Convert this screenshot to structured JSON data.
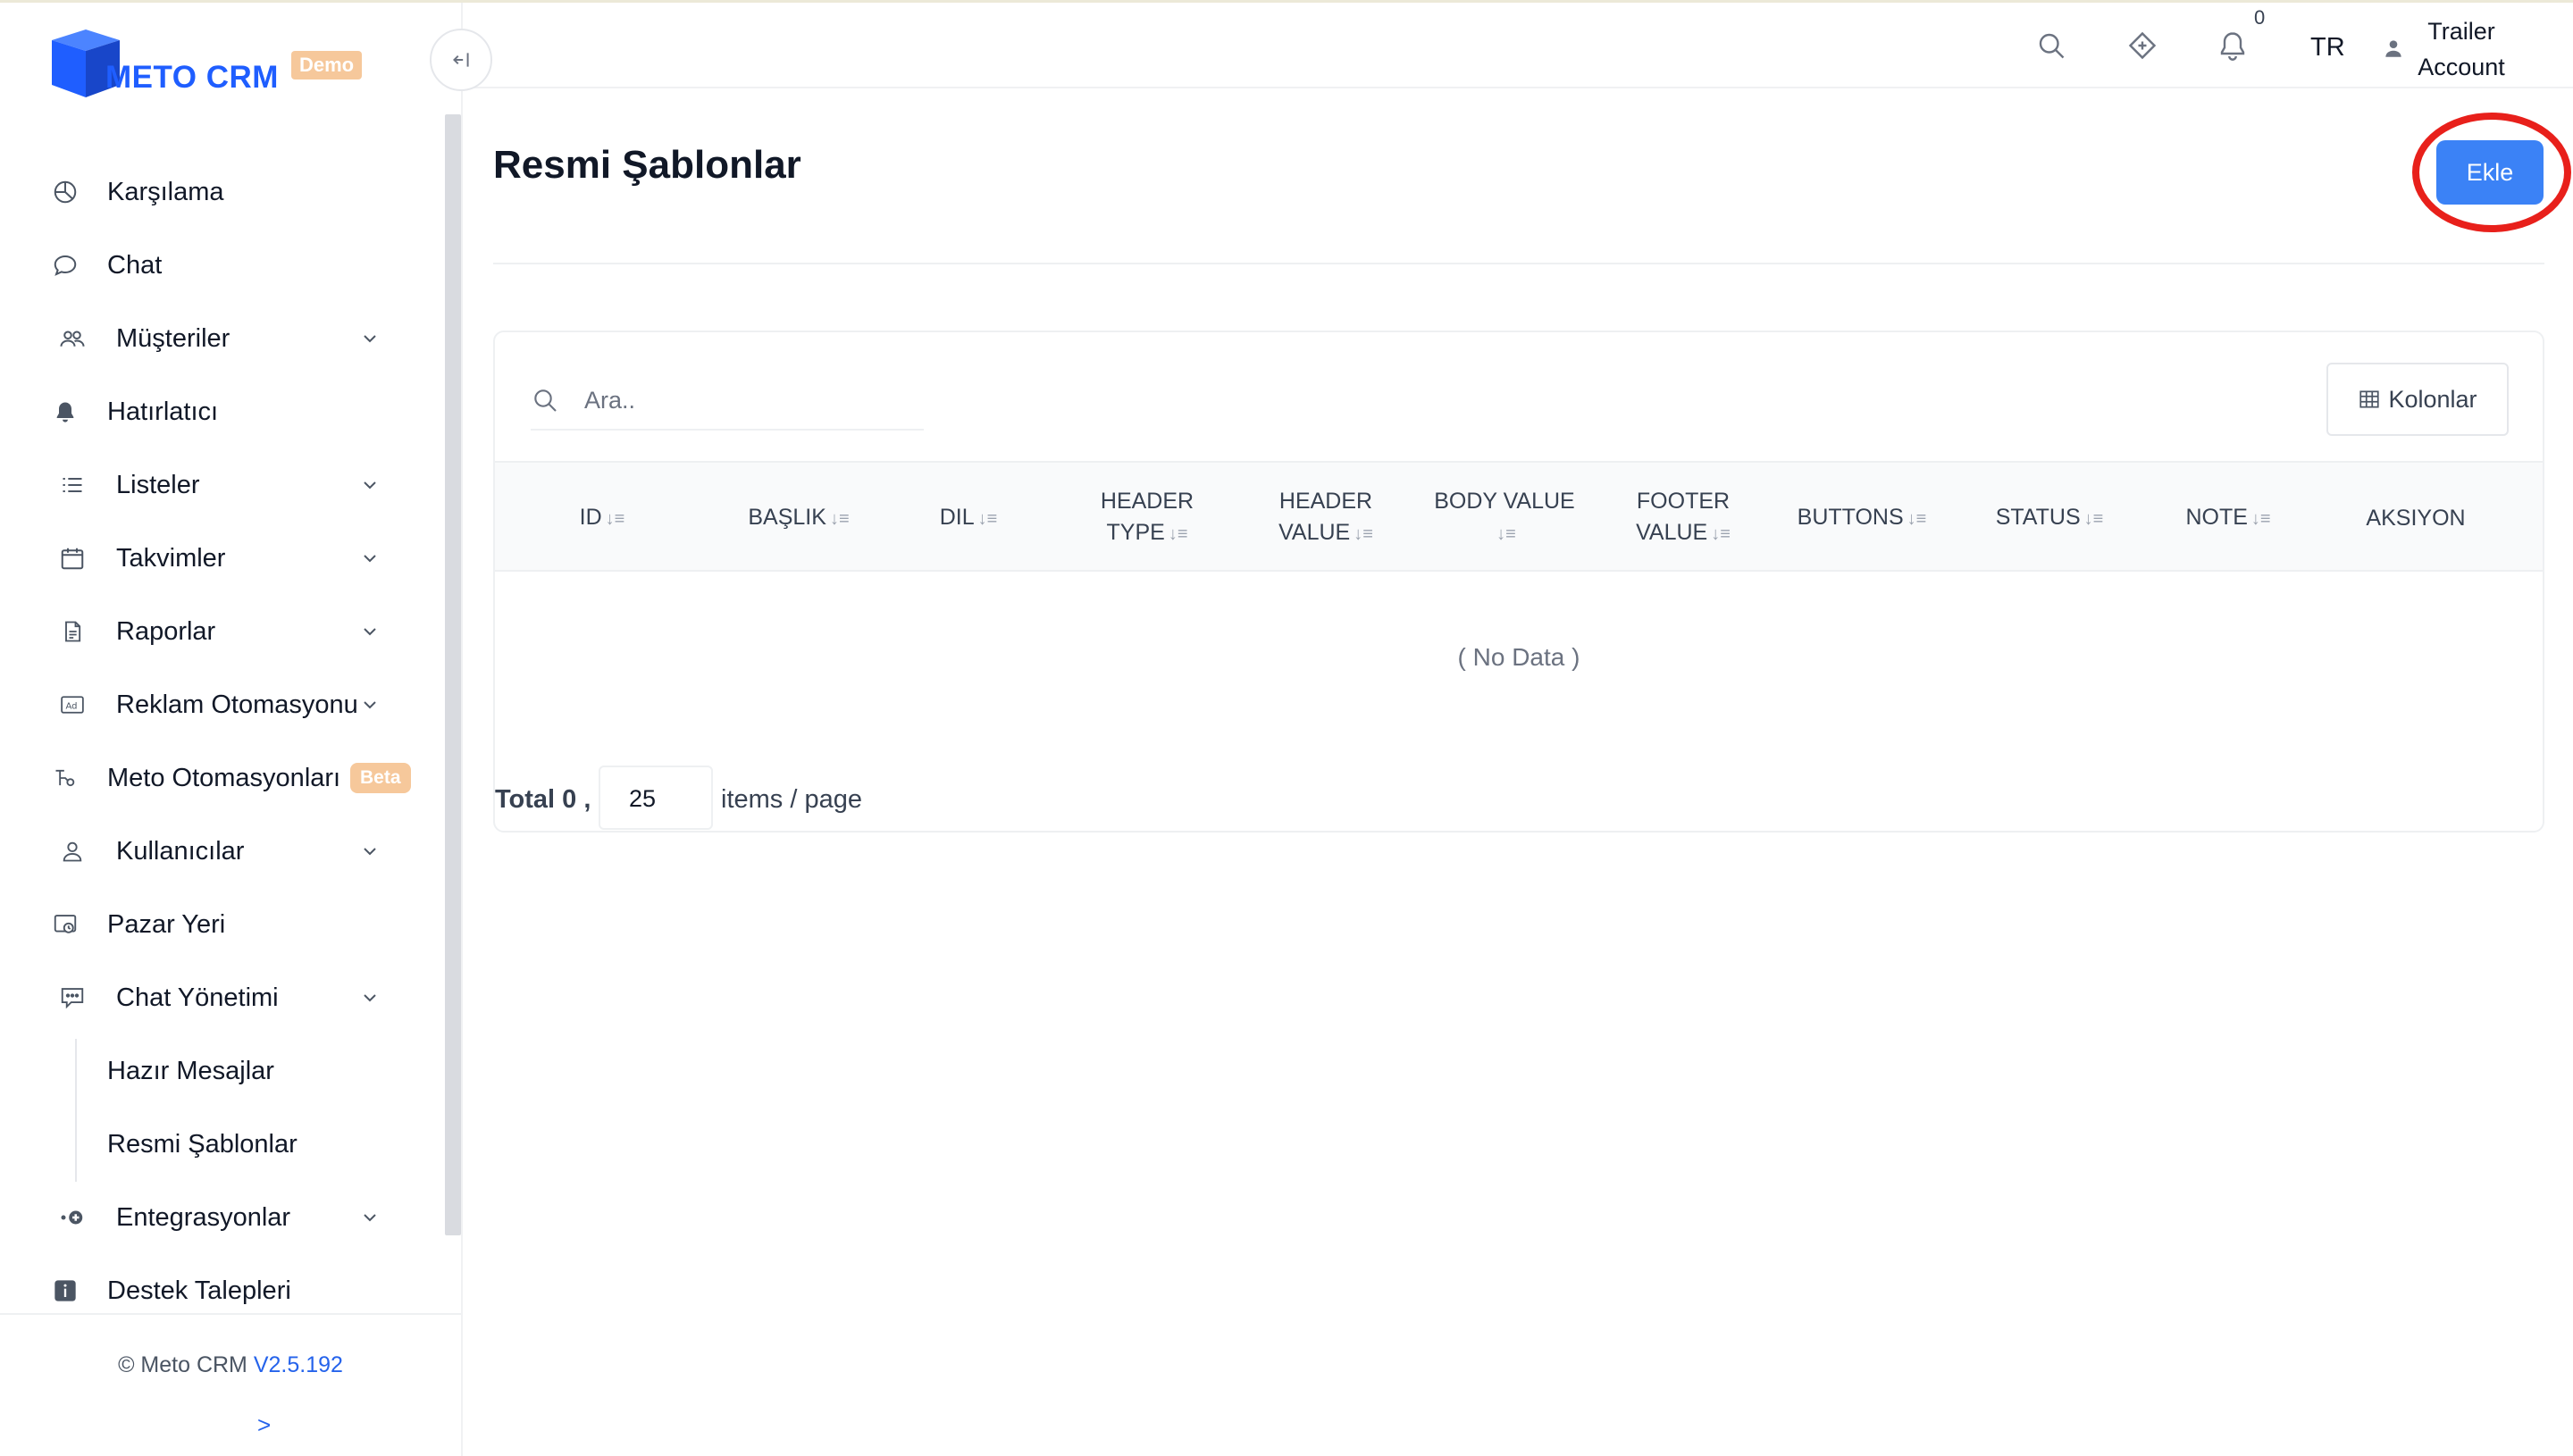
{
  "brand": {
    "name": "METO CRM",
    "badge": "Demo",
    "primary_color": "#1f5eff",
    "accent_color": "#f6c89b"
  },
  "sidebar": {
    "collapse_icon": "collapse-left-icon",
    "items": [
      {
        "label": "Karşılama",
        "icon": "pie-chart-icon",
        "has_children": false
      },
      {
        "label": "Chat",
        "icon": "chat-bubble-icon",
        "has_children": false
      },
      {
        "label": "Müşteriler",
        "icon": "users-icon",
        "has_children": true
      },
      {
        "label": "Hatırlatıcı",
        "icon": "bell-icon",
        "has_children": false
      },
      {
        "label": "Listeler",
        "icon": "list-icon",
        "has_children": true
      },
      {
        "label": "Takvimler",
        "icon": "calendar-icon",
        "has_children": true
      },
      {
        "label": "Raporlar",
        "icon": "report-icon",
        "has_children": true
      },
      {
        "label": "Reklam Otomasyonu",
        "icon": "ad-icon",
        "has_children": true
      },
      {
        "label": "Meto Otomasyonları",
        "icon": "automation-icon",
        "has_children": false,
        "badge": "Beta"
      },
      {
        "label": "Kullanıcılar",
        "icon": "user-icon",
        "has_children": true
      },
      {
        "label": "Pazar Yeri",
        "icon": "marketplace-icon",
        "has_children": false
      },
      {
        "label": "Chat Yönetimi",
        "icon": "chat-settings-icon",
        "has_children": true,
        "expanded": true
      },
      {
        "label": "Hazır Mesajlar",
        "sub": true
      },
      {
        "label": "Resmi Şablonlar",
        "sub": true,
        "active": true
      },
      {
        "label": "Entegrasyonlar",
        "icon": "integration-icon",
        "has_children": true
      },
      {
        "label": "Destek Talepleri",
        "icon": "info-icon",
        "has_children": false
      }
    ],
    "footer": {
      "copyright": "© Meto CRM",
      "version": "V2.5.192",
      "expand": ">"
    }
  },
  "header": {
    "notification_count": "0",
    "language": "TR",
    "account_line1": "Trailer",
    "account_line2": "Account"
  },
  "page": {
    "title": "Resmi Şablonlar",
    "add_button": "Ekle",
    "add_button_color": "#3b82f6",
    "highlight_color": "#e8201b"
  },
  "table": {
    "search_placeholder": "Ara..",
    "columns_button": "Kolonlar",
    "headers": [
      {
        "line1": "ID",
        "line2": ""
      },
      {
        "line1": "BAŞLIK",
        "line2": ""
      },
      {
        "line1": "DIL",
        "line2": ""
      },
      {
        "line1": "HEADER",
        "line2": "TYPE"
      },
      {
        "line1": "HEADER",
        "line2": "VALUE"
      },
      {
        "line1": "BODY VALUE",
        "line2": ""
      },
      {
        "line1": "FOOTER",
        "line2": "VALUE"
      },
      {
        "line1": "BUTTONS",
        "line2": ""
      },
      {
        "line1": "STATUS",
        "line2": ""
      },
      {
        "line1": "NOTE",
        "line2": ""
      },
      {
        "line1": "AKSIYON",
        "line2": ""
      }
    ],
    "empty_text": "( No Data )",
    "pagination": {
      "total": "Total 0 ,",
      "page_size": "25",
      "per_page": "items / page"
    }
  }
}
